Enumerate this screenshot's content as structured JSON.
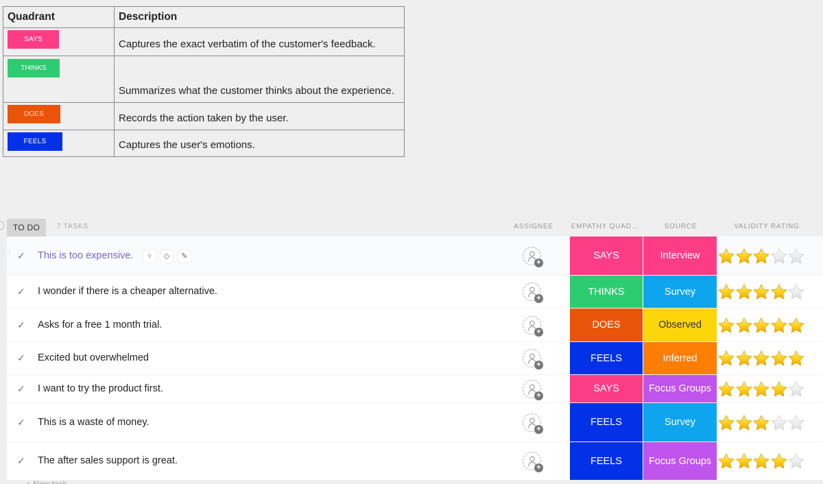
{
  "legend": {
    "headers": [
      "Quadrant",
      "Description"
    ],
    "rows": [
      {
        "quadrant": "SAYS",
        "color": "#fc3d86",
        "description": "Captures the exact verbatim of the customer's feedback."
      },
      {
        "quadrant": "THINKS",
        "color": "#2ecc71",
        "description": "Summarizes what the customer thinks about the experience."
      },
      {
        "quadrant": "DOES",
        "color": "#e8550a",
        "description": "Records the action taken by the user."
      },
      {
        "quadrant": "FEELS",
        "color": "#0231e8",
        "description": "Captures the user's emotions."
      }
    ]
  },
  "list": {
    "status_tab": "TO DO",
    "task_count": "7 TASKS",
    "columns": {
      "assignee": "ASSIGNEE",
      "quadrant": "EMPATHY QUAD...",
      "source": "SOURCE",
      "rating": "VALIDITY RATING"
    },
    "new_task": "+ New task",
    "tasks": [
      {
        "name": "This is too expensive.",
        "quadrant": "SAYS",
        "quadrant_color": "#fc3d86",
        "source": "Interview",
        "source_color": "#fc3d86",
        "rating": 3
      },
      {
        "name": "I wonder if there is a cheaper alternative.",
        "quadrant": "THINKS",
        "quadrant_color": "#2ecc71",
        "source": "Survey",
        "source_color": "#0ea5ee",
        "rating": 4
      },
      {
        "name": "Asks for a free 1 month trial.",
        "quadrant": "DOES",
        "quadrant_color": "#e8550a",
        "source": "Observed",
        "source_color": "#fcd50a",
        "rating": 5
      },
      {
        "name": "Excited but overwhelmed",
        "quadrant": "FEELS",
        "quadrant_color": "#0231e8",
        "source": "Inferred",
        "source_color": "#fd7d05",
        "rating": 5
      },
      {
        "name": "I want to try the product first.",
        "quadrant": "SAYS",
        "quadrant_color": "#fc3d86",
        "source": "Focus Groups",
        "source_color": "#bf55ec",
        "rating": 4
      },
      {
        "name": "This is a waste of money.",
        "quadrant": "FEELS",
        "quadrant_color": "#0231e8",
        "source": "Survey",
        "source_color": "#0ea5ee",
        "rating": 3
      },
      {
        "name": "The after sales support is great.",
        "quadrant": "FEELS",
        "quadrant_color": "#0231e8",
        "source": "Focus Groups",
        "source_color": "#bf55ec",
        "rating": 4
      }
    ],
    "max_rating": 5,
    "first_row_actions": [
      "subtask-icon",
      "tag-icon",
      "edit-icon"
    ]
  }
}
